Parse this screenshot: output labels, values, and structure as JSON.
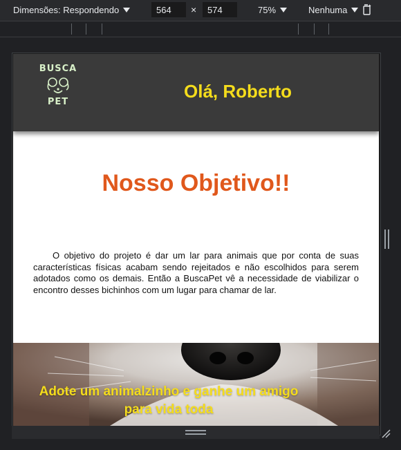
{
  "devtools": {
    "dimensions_label": "Dimensões: Respondendo",
    "width": "564",
    "separator": "×",
    "height": "574",
    "zoom": "75%",
    "throttle": "Nenhuma",
    "icons": [
      "chevron-down-icon",
      "rotate-icon",
      "resize-handle-icon"
    ]
  },
  "page": {
    "logo": {
      "line1": "BUSCA",
      "line2": "PET"
    },
    "greeting": "Olá, Roberto",
    "section_title": "Nosso Objetivo!!",
    "paragraph": "O objetivo do projeto é dar um lar para animais que por conta de suas características físicas acabam sendo rejeitados e não escolhidos para serem adotados como os demais. Então a BuscaPet vê a necessidade de viabilizar o encontro desses bichinhos com um lugar para chamar de lar.",
    "hero_text": "Adote um animalzinho e ganhe um amigo para vida toda"
  },
  "colors": {
    "header_bg": "#3a3a3a",
    "greeting": "#f4dc1c",
    "section_title": "#e0581c",
    "hero_text": "#f4dc1c"
  }
}
